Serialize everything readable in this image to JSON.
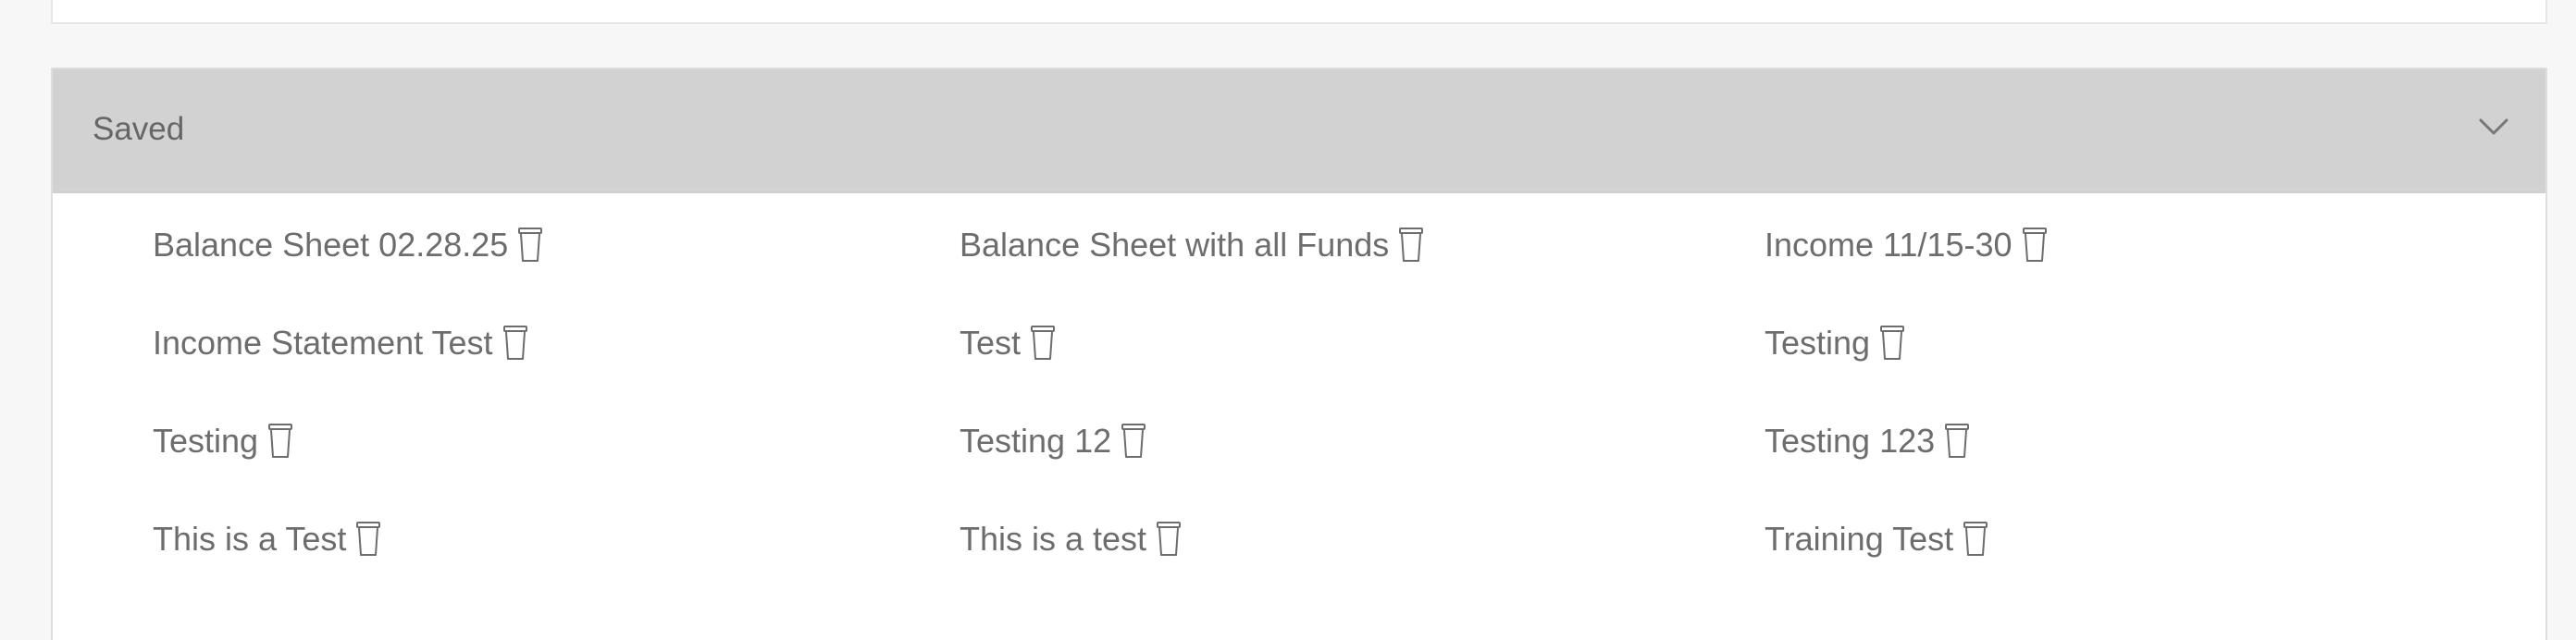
{
  "panel": {
    "title": "Saved",
    "toggle_icon": "chevron-down-icon"
  },
  "items": [
    {
      "label": "Balance Sheet 02.28.25",
      "icon": "trash-icon"
    },
    {
      "label": "Balance Sheet with all Funds",
      "icon": "trash-icon"
    },
    {
      "label": "Income 11/15-30",
      "icon": "trash-icon"
    },
    {
      "label": "Income Statement Test",
      "icon": "trash-icon"
    },
    {
      "label": "Test",
      "icon": "trash-icon"
    },
    {
      "label": "Testing",
      "icon": "trash-icon"
    },
    {
      "label": "Testing",
      "icon": "trash-icon"
    },
    {
      "label": "Testing 12",
      "icon": "trash-icon"
    },
    {
      "label": "Testing 123",
      "icon": "trash-icon"
    },
    {
      "label": "This is a Test",
      "icon": "trash-icon"
    },
    {
      "label": "This is a test",
      "icon": "trash-icon"
    },
    {
      "label": "Training Test",
      "icon": "trash-icon"
    }
  ]
}
